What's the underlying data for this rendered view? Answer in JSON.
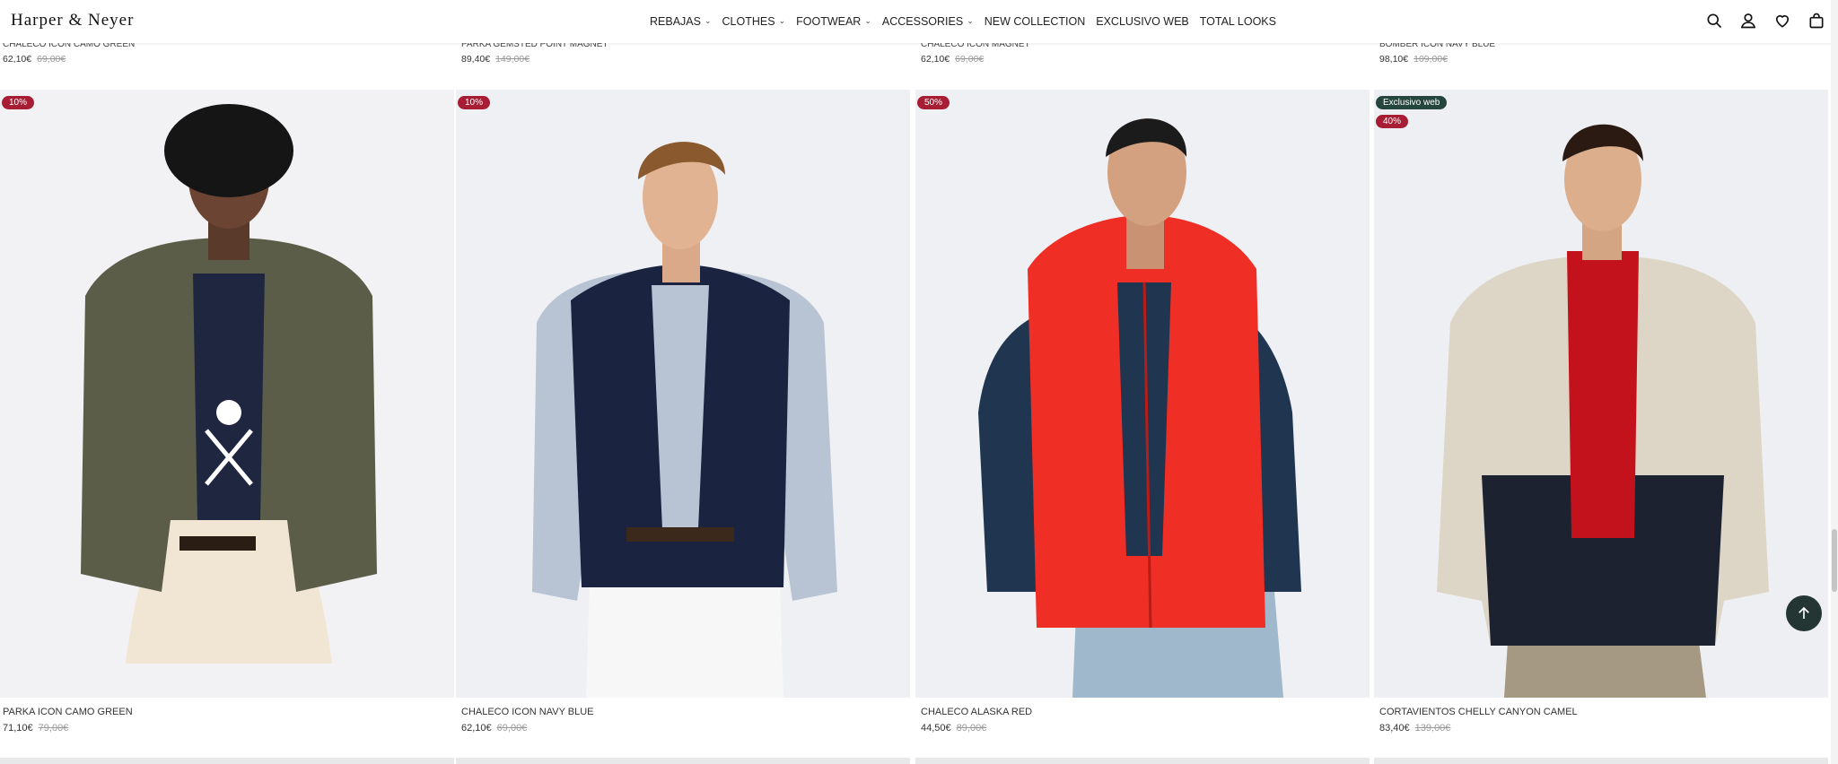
{
  "header": {
    "logo": "Harper & Neyer",
    "nav": [
      {
        "label": "REBAJAS",
        "dropdown": true
      },
      {
        "label": "CLOTHES",
        "dropdown": true
      },
      {
        "label": "FOOTWEAR",
        "dropdown": true
      },
      {
        "label": "ACCESSORIES",
        "dropdown": true
      },
      {
        "label": "NEW COLLECTION",
        "dropdown": false
      },
      {
        "label": "EXCLUSIVO WEB",
        "dropdown": false
      },
      {
        "label": "TOTAL LOOKS",
        "dropdown": false
      }
    ],
    "icons": [
      "search-icon",
      "user-icon",
      "heart-icon",
      "bag-icon"
    ]
  },
  "prev_row": [
    {
      "name": "CHALECO ICON CAMO GREEN",
      "price": "62,10€",
      "old_price": "69,00€"
    },
    {
      "name": "PARKA GEMSTED POINT MAGNET",
      "price": "89,40€",
      "old_price": "149,00€"
    },
    {
      "name": "CHALECO ICON MAGNET",
      "price": "62,10€",
      "old_price": "69,00€"
    },
    {
      "name": "BOMBER ICON NAVY BLUE",
      "price": "98,10€",
      "old_price": "109,00€"
    }
  ],
  "products": [
    {
      "name": "PARKA ICON CAMO GREEN",
      "price": "71,10€",
      "old_price": "79,00€",
      "badges": [
        "10%"
      ],
      "jacket_color": "#5b5d48",
      "bg": "#f2f2f4"
    },
    {
      "name": "CHALECO ICON NAVY BLUE",
      "price": "62,10€",
      "old_price": "69,00€",
      "badges": [
        "10%"
      ],
      "jacket_color": "#1a2440",
      "bg": "#eef0f3"
    },
    {
      "name": "CHALECO ALASKA RED",
      "price": "44,50€",
      "old_price": "89,00€",
      "badges": [
        "50%"
      ],
      "jacket_color": "#ef2e26",
      "bg": "#eff0f3"
    },
    {
      "name": "CORTAVIENTOS CHELLY CANYON CAMEL",
      "price": "83,40€",
      "old_price": "139,00€",
      "badges": [
        "Exclusivo web",
        "40%"
      ],
      "jacket_color": "#ddd5c6",
      "bg": "#eeeff2"
    }
  ],
  "colors": {
    "badge": "#a71d34",
    "badge_exclusive": "#24463d",
    "scroll_top": "#243634"
  }
}
